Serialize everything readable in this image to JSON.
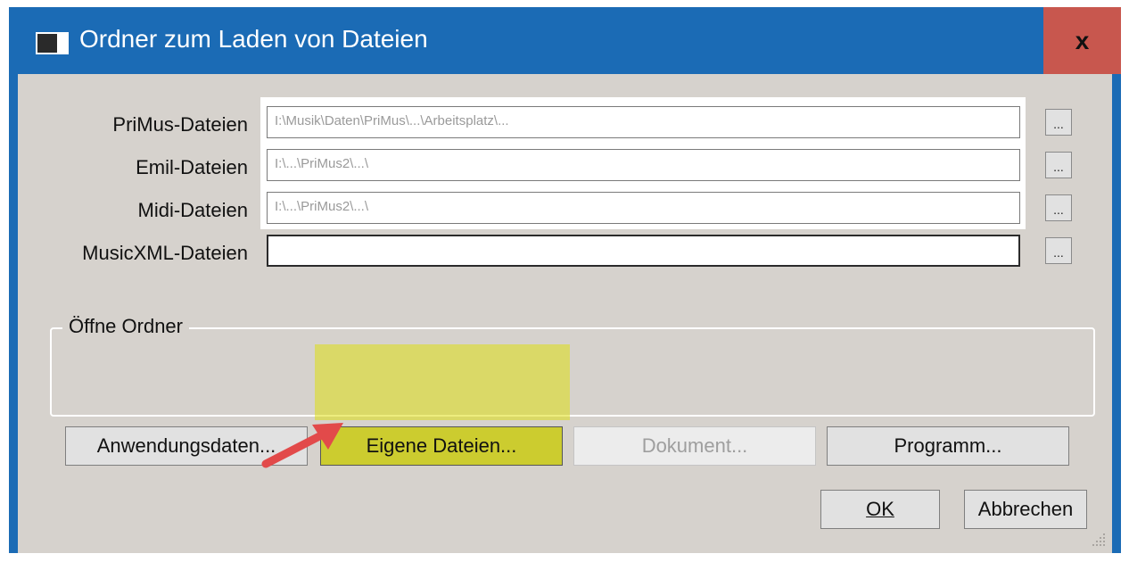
{
  "window": {
    "title": "Ordner zum Laden von Dateien",
    "close_label": "x"
  },
  "fields": [
    {
      "label": "PriMus-Dateien",
      "value": "I:\\Musik\\Daten\\PriMus\\...\\Arbeitsplatz\\...",
      "browse": "..."
    },
    {
      "label": "Emil-Dateien",
      "value": "I:\\...\\PriMus2\\...\\",
      "browse": "..."
    },
    {
      "label": "Midi-Dateien",
      "value": "I:\\...\\PriMus2\\...\\",
      "browse": "..."
    },
    {
      "label": "MusicXML-Dateien",
      "value": "",
      "browse": "..."
    }
  ],
  "group": {
    "legend": "Öffne Ordner",
    "buttons": [
      {
        "label": "Anwendungsdaten...",
        "enabled": true
      },
      {
        "label": "Eigene Dateien...",
        "enabled": true,
        "highlighted": true
      },
      {
        "label": "Dokument...",
        "enabled": false
      },
      {
        "label": "Programm...",
        "enabled": true
      }
    ]
  },
  "footer": {
    "ok_label": "OK",
    "cancel_label": "Abbrechen"
  },
  "colors": {
    "titlebar": "#1b6bb5",
    "close": "#c8574e",
    "client": "#d6d2cd",
    "highlight": "#dede14",
    "arrow": "#e24a4a"
  }
}
